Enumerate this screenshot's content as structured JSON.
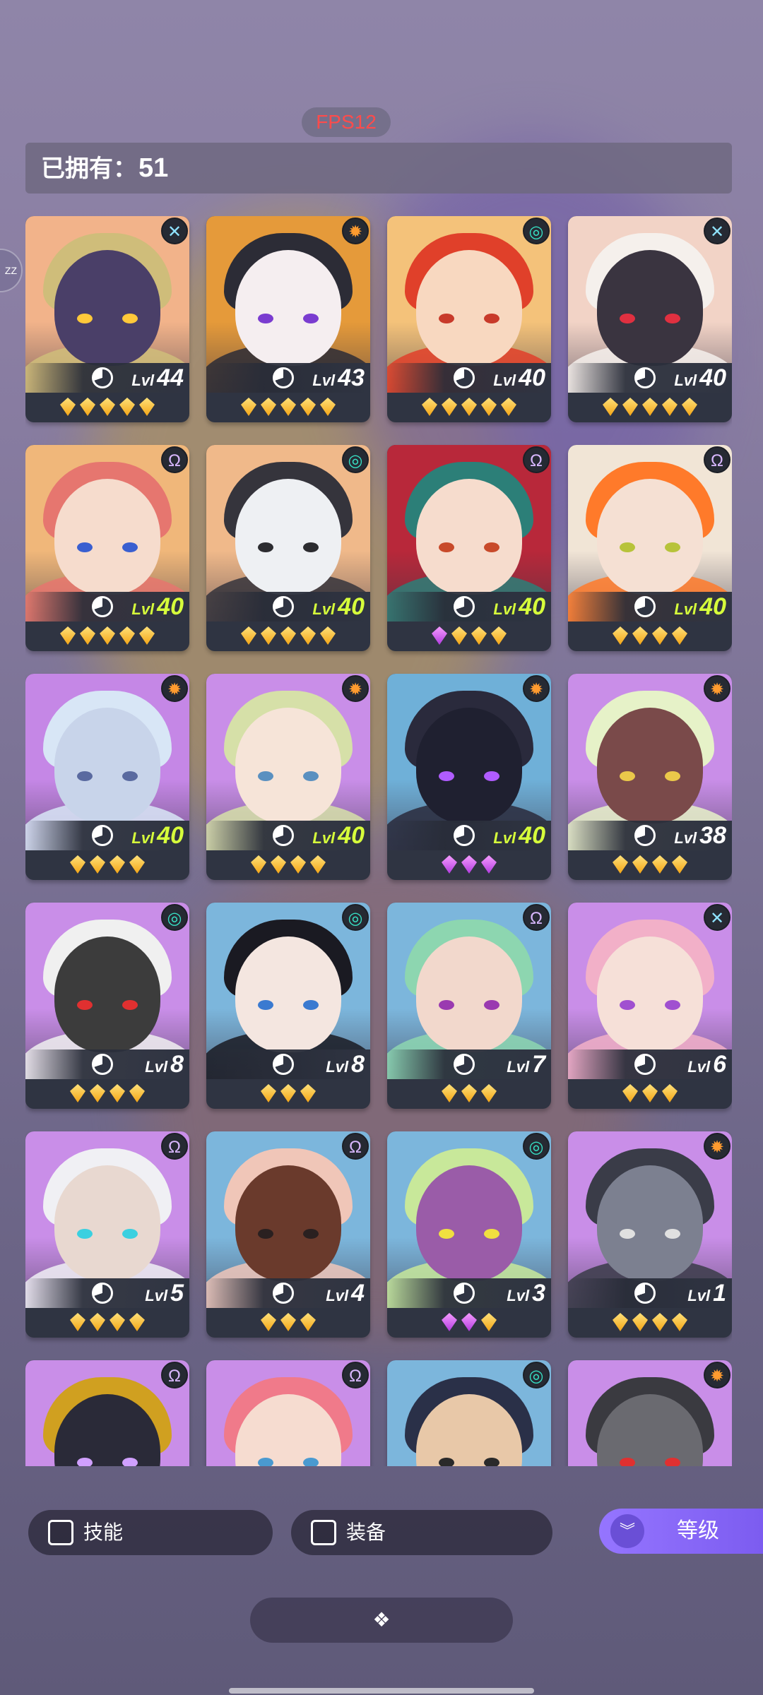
{
  "fps_label": "FPS12",
  "owned": {
    "label": "已拥有：",
    "count": "51"
  },
  "side_tab_label": "ZZ",
  "level_prefix": "Lvl",
  "heroes": [
    {
      "level": "44",
      "lvl_color": "white",
      "class": "x",
      "class_color": "blue",
      "gems": [
        "gold",
        "gold",
        "gold",
        "gold",
        "gold"
      ],
      "bg": "#f2b38a",
      "hair": "#cfbd7a",
      "skin": "#4a3f68",
      "eye": "#ffc93a"
    },
    {
      "level": "43",
      "lvl_color": "white",
      "class": "gear",
      "class_color": "orange",
      "gems": [
        "gold",
        "gold",
        "gold",
        "gold",
        "gold"
      ],
      "bg": "#e59a3a",
      "hair": "#2c2c36",
      "skin": "#f5eef0",
      "eye": "#7a3cd0"
    },
    {
      "level": "40",
      "lvl_color": "white",
      "class": "swirl",
      "class_color": "teal",
      "gems": [
        "gold",
        "gold",
        "gold",
        "gold",
        "gold"
      ],
      "bg": "#f4c27a",
      "hair": "#e0402a",
      "skin": "#f8d8c0",
      "eye": "#c83a2a"
    },
    {
      "level": "40",
      "lvl_color": "white",
      "class": "x",
      "class_color": "blue",
      "gems": [
        "gold",
        "gold",
        "gold",
        "gold",
        "gold"
      ],
      "bg": "#f2d3c6",
      "hair": "#f5f0ec",
      "skin": "#3a3440",
      "eye": "#e03040"
    },
    {
      "level": "40",
      "lvl_color": "yellow",
      "class": "omega",
      "class_color": "purple",
      "gems": [
        "gold",
        "gold",
        "gold",
        "gold",
        "gold"
      ],
      "bg": "#f0b77a",
      "hair": "#e6766f",
      "skin": "#f6dccd",
      "eye": "#3a5fd0"
    },
    {
      "level": "40",
      "lvl_color": "yellow",
      "class": "swirl",
      "class_color": "teal",
      "gems": [
        "gold",
        "gold",
        "gold",
        "gold",
        "gold"
      ],
      "bg": "#f0b98a",
      "hair": "#35343c",
      "skin": "#eef0f3",
      "eye": "#2c2c30"
    },
    {
      "level": "40",
      "lvl_color": "yellow",
      "class": "omega",
      "class_color": "purple",
      "gems": [
        "purple",
        "gold",
        "gold",
        "gold"
      ],
      "bg": "#b8283a",
      "hair": "#2c7f78",
      "skin": "#f6dccd",
      "eye": "#c84a2a"
    },
    {
      "level": "40",
      "lvl_color": "yellow",
      "class": "omega",
      "class_color": "purple",
      "gems": [
        "gold",
        "gold",
        "gold",
        "gold"
      ],
      "bg": "#f1e5d6",
      "hair": "#ff7a2a",
      "skin": "#f5e0d3",
      "eye": "#b7c33a"
    },
    {
      "level": "40",
      "lvl_color": "yellow",
      "class": "gear",
      "class_color": "orange",
      "gems": [
        "gold",
        "gold",
        "gold",
        "gold"
      ],
      "bg": "#c587e6",
      "hair": "#d8e6f6",
      "skin": "#c8d4ea",
      "eye": "#5a6aa0"
    },
    {
      "level": "40",
      "lvl_color": "yellow",
      "class": "gear",
      "class_color": "orange",
      "gems": [
        "gold",
        "gold",
        "gold",
        "gold"
      ],
      "bg": "#c98ee8",
      "hair": "#d6e0a8",
      "skin": "#f6e4d8",
      "eye": "#5a90c0"
    },
    {
      "level": "40",
      "lvl_color": "yellow",
      "class": "gear",
      "class_color": "orange",
      "gems": [
        "purple",
        "purple",
        "purple"
      ],
      "bg": "#6fb0d8",
      "hair": "#2a2a3c",
      "skin": "#1f2030",
      "eye": "#b05cff"
    },
    {
      "level": "38",
      "lvl_color": "white",
      "class": "gear",
      "class_color": "orange",
      "gems": [
        "gold",
        "gold",
        "gold",
        "gold"
      ],
      "bg": "#c98ee8",
      "hair": "#e6f2c8",
      "skin": "#7a4a4a",
      "eye": "#eac84a"
    },
    {
      "level": "8",
      "lvl_color": "white",
      "class": "swirl",
      "class_color": "teal",
      "gems": [
        "gold",
        "gold",
        "gold",
        "gold"
      ],
      "bg": "#c98ee8",
      "hair": "#f0f0f0",
      "skin": "#3c3c3c",
      "eye": "#e03030"
    },
    {
      "level": "8",
      "lvl_color": "white",
      "class": "swirl",
      "class_color": "teal",
      "gems": [
        "gold",
        "gold",
        "gold"
      ],
      "bg": "#7cb6dc",
      "hair": "#1a1a22",
      "skin": "#f4e6e0",
      "eye": "#3a7ad0"
    },
    {
      "level": "7",
      "lvl_color": "white",
      "class": "omega",
      "class_color": "purple",
      "gems": [
        "gold",
        "gold",
        "gold"
      ],
      "bg": "#7cb6dc",
      "hair": "#8dd6b0",
      "skin": "#f2d8cc",
      "eye": "#9a3ab0"
    },
    {
      "level": "6",
      "lvl_color": "white",
      "class": "x",
      "class_color": "blue",
      "gems": [
        "gold",
        "gold",
        "gold"
      ],
      "bg": "#c98ee8",
      "hair": "#f2b0c8",
      "skin": "#f6e0d8",
      "eye": "#a050d0"
    },
    {
      "level": "5",
      "lvl_color": "white",
      "class": "omega",
      "class_color": "purple",
      "gems": [
        "gold",
        "gold",
        "gold",
        "gold"
      ],
      "bg": "#c98ee8",
      "hair": "#f0f0f4",
      "skin": "#e8d8d0",
      "eye": "#3ad0e0"
    },
    {
      "level": "4",
      "lvl_color": "white",
      "class": "omega",
      "class_color": "purple",
      "gems": [
        "gold",
        "gold",
        "gold"
      ],
      "bg": "#7cb6dc",
      "hair": "#f0c6b8",
      "skin": "#6a3a2c",
      "eye": "#2a2020"
    },
    {
      "level": "3",
      "lvl_color": "white",
      "class": "swirl",
      "class_color": "teal",
      "gems": [
        "purple",
        "purple",
        "gold"
      ],
      "bg": "#7cb6dc",
      "hair": "#c8e89a",
      "skin": "#9a5ca8",
      "eye": "#f0e040"
    },
    {
      "level": "1",
      "lvl_color": "white",
      "class": "gear",
      "class_color": "orange",
      "gems": [
        "gold",
        "gold",
        "gold",
        "gold"
      ],
      "bg": "#c98ee8",
      "hair": "#3a3c48",
      "skin": "#7c8090",
      "eye": "#e0e0e0"
    },
    {
      "level": "",
      "lvl_color": "white",
      "class": "omega",
      "class_color": "purple",
      "gems": [],
      "bg": "#c98ee8",
      "hair": "#d0a020",
      "skin": "#2a2a38",
      "eye": "#d0a0ff"
    },
    {
      "level": "",
      "lvl_color": "white",
      "class": "omega",
      "class_color": "purple",
      "gems": [],
      "bg": "#c98ee8",
      "hair": "#f07a8a",
      "skin": "#f6dcd0",
      "eye": "#4a9ad0"
    },
    {
      "level": "",
      "lvl_color": "white",
      "class": "swirl",
      "class_color": "teal",
      "gems": [],
      "bg": "#7cb6dc",
      "hair": "#2a3048",
      "skin": "#e8c8a8",
      "eye": "#2a2a2a"
    },
    {
      "level": "",
      "lvl_color": "white",
      "class": "gear",
      "class_color": "orange",
      "gems": [],
      "bg": "#c98ee8",
      "hair": "#3a3a40",
      "skin": "#6a6a70",
      "eye": "#e03030"
    }
  ],
  "filters": {
    "skill_label": "技能",
    "equip_label": "装备"
  },
  "sort": {
    "label": "等级"
  },
  "colors": {
    "accent": "#8b6cff",
    "gold_gem": "#f3a516",
    "purple_gem": "#c44be6",
    "level_highlight": "#d7ff3b"
  }
}
